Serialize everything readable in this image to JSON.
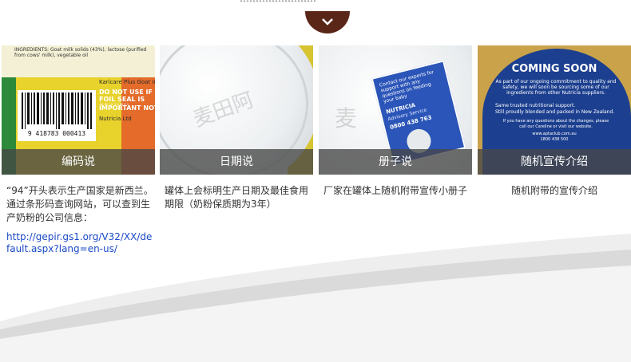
{
  "header": {
    "partial_text": "……………………"
  },
  "cards": [
    {
      "title": "编码说",
      "description": "“94”开头表示生产国家是新西兰。通过条形码查询网站，可以查到生产奶粉的公司信息：",
      "link": "http://gepir.gs1.org/V32/XX/default.aspx?lang=en-us/",
      "photo": {
        "ingredients": "INGREDIENTS: Goat milk solids (43%), lactose (purified from cows' milk), vegetable oil",
        "brand": "Karicare Plus Goat Infant Formula",
        "warning": "DO NOT USE IF FOIL SEAL IS BROKEN",
        "notice": "IMPORTANT NOTICE",
        "company": "Nutricia Ltd",
        "barcode": "9 418783 000413"
      }
    },
    {
      "title": "日期说",
      "description": "罐体上会标明生产日期及最佳食用期限（奶粉保质期为3年）",
      "photo": {
        "watermark": "麦田阿"
      }
    },
    {
      "title": "册子说",
      "description": "厂家在罐体上随机附带宣传小册子",
      "photo": {
        "booklet_text": "Contact our experts for support with any questions on feeding your baby",
        "booklet_brand": "NUTRICIA",
        "booklet_sub": "Advisory Service",
        "phone": "0800 438 763",
        "watermark": "麦"
      }
    },
    {
      "title": "随机宣传介绍",
      "description": "随机附带的宣传介绍",
      "photo": {
        "headline": "COMING SOON",
        "body": "As part of our ongoing commitment to quality and safety, we will soon be sourcing some of our ingredients from other Nutricia suppliers.",
        "bullet1": "Same trusted nutritional support.",
        "bullet2": "Still proudly blended and packed in New Zealand.",
        "footer1": "If you have any questions about the changes, please call our Careline or visit our website.",
        "site": "www.aptaclub.com.au",
        "phone": "1800 438 500"
      }
    }
  ],
  "colors": {
    "badge": "#5a2618",
    "caption_bar": "#464646",
    "link": "#1a49c6",
    "card4_label": "#1c3f8f"
  }
}
